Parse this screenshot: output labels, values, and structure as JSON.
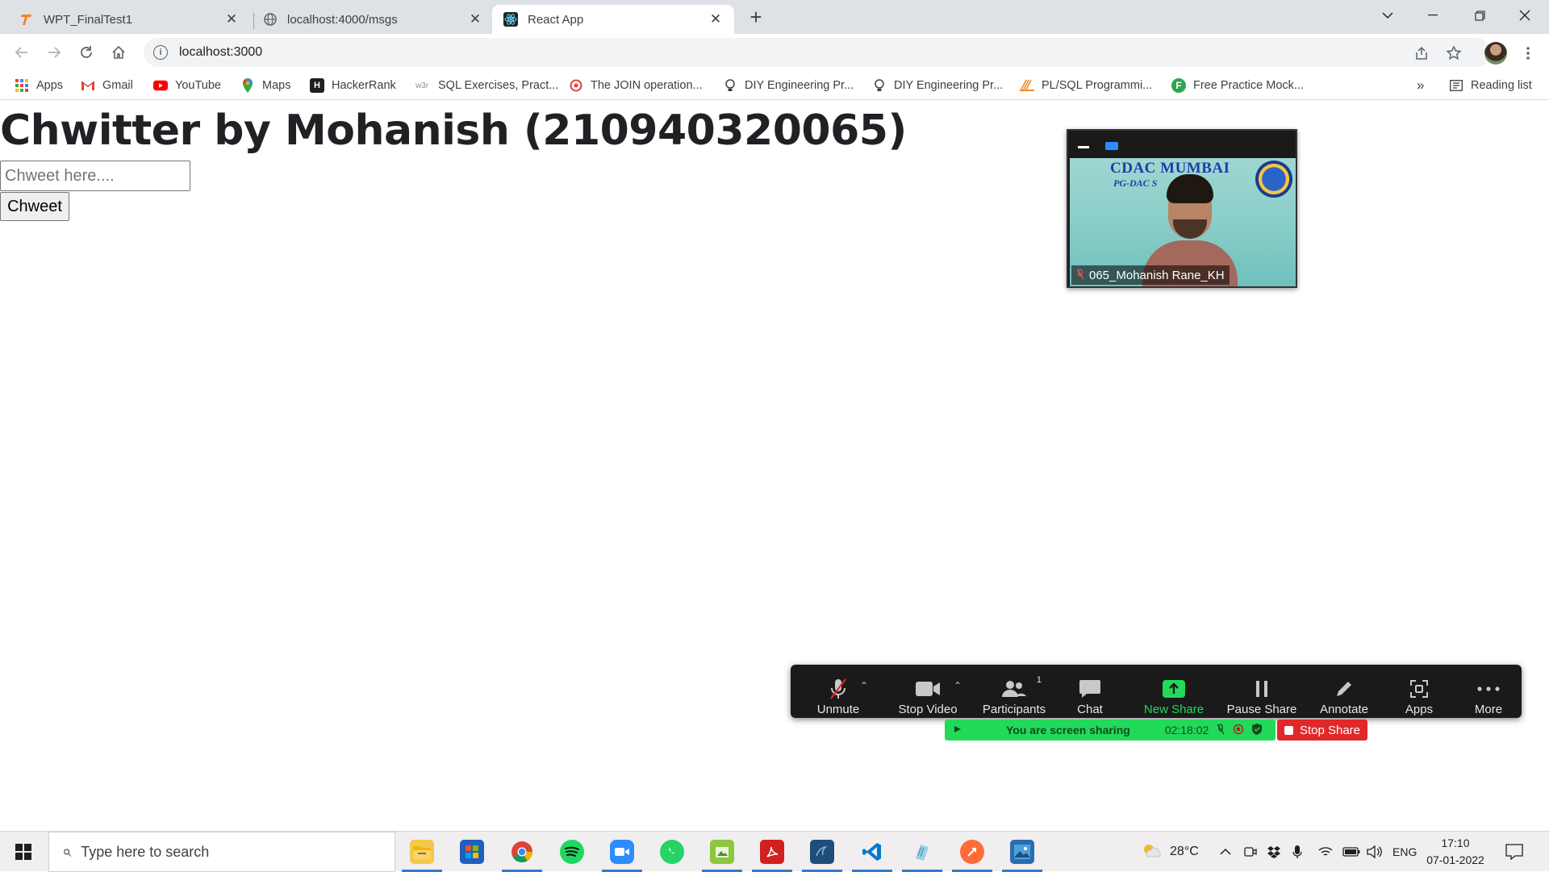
{
  "browser": {
    "tabs": [
      {
        "title": "WPT_FinalTest1",
        "favicon": "t-logo-icon",
        "active": false
      },
      {
        "title": "localhost:4000/msgs",
        "favicon": "globe-icon",
        "active": false
      },
      {
        "title": "React App",
        "favicon": "react-icon",
        "active": true
      }
    ],
    "new_tab": "+",
    "url": "localhost:3000",
    "bookmarks": [
      {
        "label": "Apps",
        "icon": "apps-grid-icon",
        "color": "#4285f4"
      },
      {
        "label": "Gmail",
        "icon": "gmail-icon",
        "color": "#ea4335"
      },
      {
        "label": "YouTube",
        "icon": "youtube-icon",
        "color": "#ff0000"
      },
      {
        "label": "Maps",
        "icon": "maps-icon",
        "color": "#34a853"
      },
      {
        "label": "HackerRank",
        "icon": "hackerrank-icon",
        "color": "#1f1f1f"
      },
      {
        "label": "SQL Exercises, Pract...",
        "icon": "w3r-icon",
        "color": "#8c8c8c"
      },
      {
        "label": "The JOIN operation...",
        "icon": "sqlzoo-icon",
        "color": "#e04040"
      },
      {
        "label": "DIY Engineering Pr...",
        "icon": "bulb-icon",
        "color": "#3c4043"
      },
      {
        "label": "DIY Engineering Pr...",
        "icon": "bulb-icon",
        "color": "#3c4043"
      },
      {
        "label": "PL/SQL Programmi...",
        "icon": "plsql-icon",
        "color": "#f08a24"
      },
      {
        "label": "Free Practice Mock...",
        "icon": "f-circle-icon",
        "color": "#2ea44f"
      }
    ],
    "more_bookmarks": "»",
    "reading_list": "Reading list"
  },
  "page": {
    "title": "Chwitter by Mohanish (210940320065)",
    "input_placeholder": "Chweet here....",
    "button_label": "Chweet"
  },
  "video": {
    "banner_line1": "CDAC MUMBAI",
    "banner_line2": "PG-DAC S",
    "participant_name": "065_Mohanish Rane_KH"
  },
  "zoom": {
    "controls": [
      {
        "label": "Unmute",
        "icon": "mic-muted-icon"
      },
      {
        "label": "Stop Video",
        "icon": "video-camera-icon"
      },
      {
        "label": "Participants",
        "icon": "participants-icon",
        "badge": "1"
      },
      {
        "label": "Chat",
        "icon": "chat-icon"
      },
      {
        "label": "New Share",
        "icon": "share-screen-icon"
      },
      {
        "label": "Pause Share",
        "icon": "pause-icon"
      },
      {
        "label": "Annotate",
        "icon": "pencil-icon"
      },
      {
        "label": "Apps",
        "icon": "apps-icon"
      },
      {
        "label": "More",
        "icon": "more-dots-icon"
      }
    ],
    "sharing_label": "You are screen sharing",
    "sharing_timer": "02:18:02",
    "stop_share": "Stop Share",
    "accent_green": "#23d959",
    "stop_red": "#e02828"
  },
  "taskbar": {
    "search_placeholder": "Type here to search",
    "apps": [
      "file-explorer-icon",
      "microsoft-store-icon",
      "chrome-icon",
      "spotify-icon",
      "zoom-icon",
      "whatsapp-icon",
      "snipping-icon",
      "acrobat-icon",
      "mysql-workbench-icon",
      "vscode-icon",
      "notepad-icon",
      "postman-icon",
      "photos-icon"
    ],
    "weather": "28°C",
    "language": "ENG",
    "time": "17:10",
    "date": "07-01-2022"
  }
}
